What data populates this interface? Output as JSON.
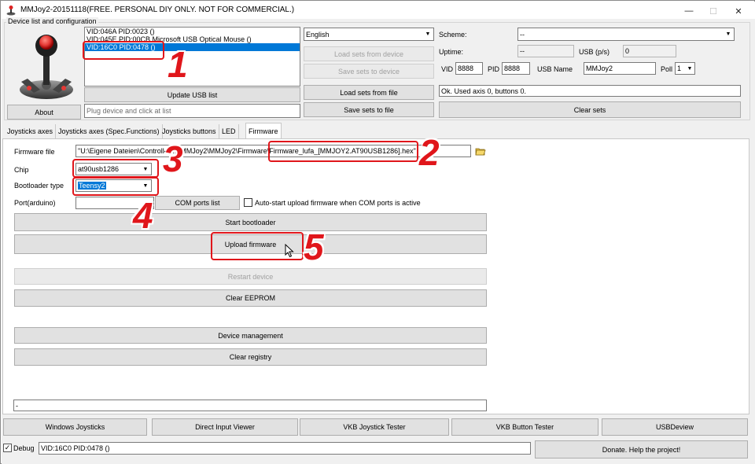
{
  "window": {
    "title": "MMJoy2-20151118(FREE. PERSONAL DIY ONLY. NOT FOR COMMERCIAL.)",
    "controls": {
      "minimize": "—",
      "maximize": "☐",
      "close": "✕"
    }
  },
  "device_group": {
    "label": "Device list and configuration",
    "about_label": "About",
    "devices": [
      "VID:046A PID:0023  ()",
      "VID:045E PID:00CB Microsoft USB Optical Mouse ()",
      "VID:16C0 PID:0478  ()"
    ],
    "selected_index": 2,
    "update_usb_label": "Update USB list",
    "status_placeholder": "Plug device and click at list"
  },
  "middle": {
    "language": "English",
    "load_sets_from_device": "Load sets from device",
    "save_sets_to_device": "Save sets to device",
    "load_sets_from_file": "Load sets from file",
    "save_sets_to_file": "Save sets to file"
  },
  "right": {
    "scheme_label": "Scheme:",
    "scheme_value": "--",
    "uptime_label": "Uptime:",
    "uptime_value": "--",
    "usb_ps_label": "USB (p/s)",
    "usb_ps_value": "0",
    "vid_label": "VID",
    "vid_value": "8888",
    "pid_label": "PID",
    "pid_value": "8888",
    "usb_name_label": "USB Name",
    "usb_name_value": "MMJoy2",
    "poll_label": "Poll",
    "poll_value": "1",
    "status_text": "Ok. Used axis  0, buttons 0.",
    "clear_sets": "Clear sets"
  },
  "tabs": [
    {
      "label": "Joysticks axes"
    },
    {
      "label": "Joysticks axes (Spec.Functions)"
    },
    {
      "label": "Joysticks buttons"
    },
    {
      "label": "LED"
    },
    {
      "label": "Firmware"
    }
  ],
  "firmware": {
    "file_label": "Firmware file",
    "file_value": "\"U:\\Eigene Dateien\\Controller\\...\\MMJoy2\\MMJoy2\\Firmware\\Firmware_lufa_[MMJOY2.AT90USB1286].hex\"",
    "chip_label": "Chip",
    "chip_value": "at90usb1286",
    "bootloader_label": "Bootloader type",
    "bootloader_value": "Teensy2",
    "port_label": "Port(arduino)",
    "port_value": "",
    "com_ports_list": "COM ports list",
    "autostart_label": "Auto-start upload firmware when COM ports is active",
    "start_bootloader": "Start bootloader",
    "upload_firmware": "Upload firmware",
    "restart_device": "Restart device",
    "clear_eeprom": "Clear EEPROM",
    "device_management": "Device management",
    "clear_registry": "Clear registry",
    "log_text": "-"
  },
  "bottom": {
    "windows_joysticks": "Windows Joysticks",
    "direct_input_viewer": "Direct Input Viewer",
    "vkb_joystick_tester": "VKB Joystick Tester",
    "vkb_button_tester": "VKB Button Tester",
    "usbdeview": "USBDeview",
    "debug_label": "Debug",
    "debug_checked": "✓",
    "debug_value": "VID:16C0 PID:0478  ()",
    "donate": "Donate. Help the project!"
  },
  "annotations": [
    "1",
    "2",
    "3",
    "4",
    "5"
  ],
  "colors": {
    "selection": "#0078d7",
    "annotation_red": "#e0161b"
  }
}
